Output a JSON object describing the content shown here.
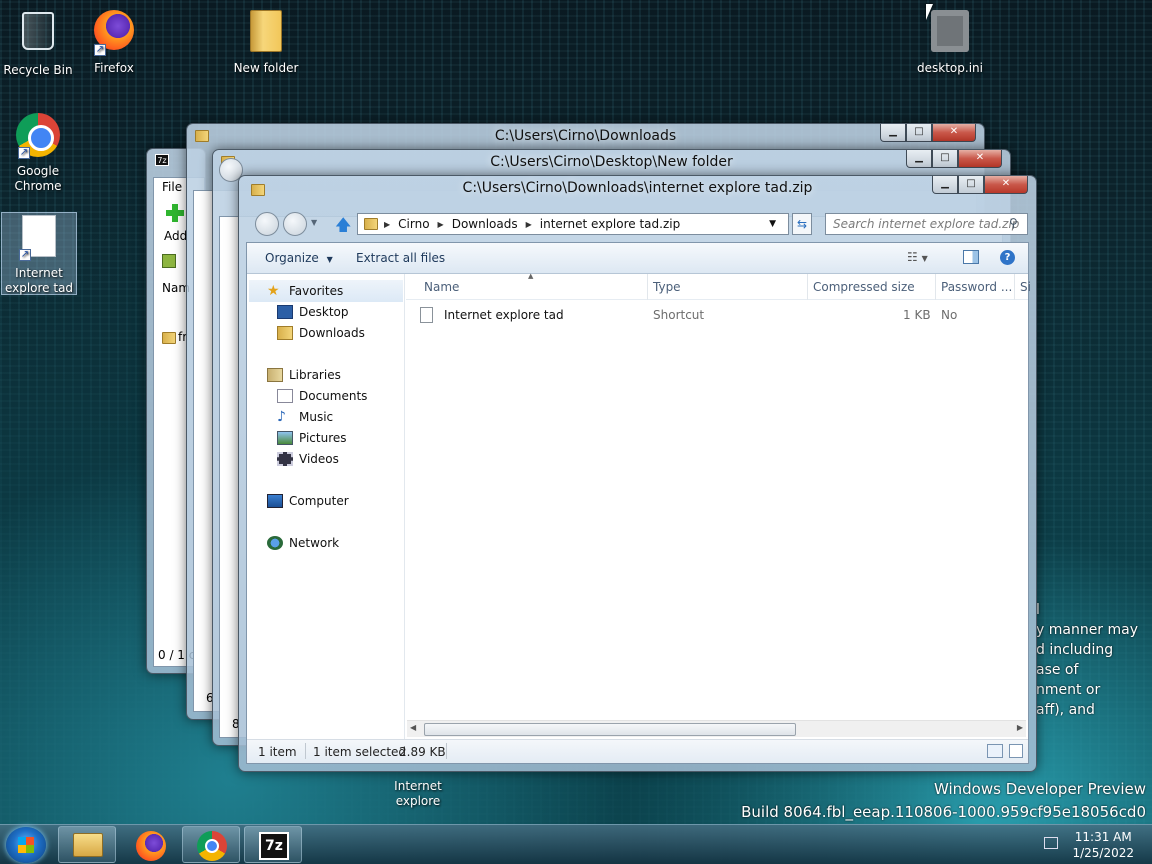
{
  "desktop": {
    "icons": [
      {
        "label": "Recycle Bin",
        "icon": "recycle-bin-icon"
      },
      {
        "label": "Firefox",
        "icon": "firefox-icon"
      },
      {
        "label": "New folder",
        "icon": "folder-icon"
      },
      {
        "label": "desktop.ini",
        "icon": "settings-file-icon"
      },
      {
        "label": "Google Chrome",
        "icon": "chrome-icon"
      },
      {
        "label": "Internet explore tad",
        "icon": "shortcut-file-icon"
      },
      {
        "label": "Internet explore",
        "icon": "shortcut-file-icon"
      }
    ],
    "legal_lines": [
      "l",
      "y manner may",
      "d including",
      "ase of",
      "nment or",
      "aff), and"
    ],
    "watermark": {
      "line1": "Windows Developer Preview",
      "line2": "Build 8064.fbl_eeap.110806-1000.959cf95e18056cd0"
    }
  },
  "windows": {
    "downloads": {
      "title": "C:\\Users\\Cirno\\Downloads",
      "status_fragment": "6"
    },
    "new_folder": {
      "title": "C:\\Users\\Cirno\\Desktop\\New folder",
      "status_fragment": "8"
    },
    "sevenzip": {
      "menu_file": "File",
      "add_label": "Add",
      "col_name": "Nam",
      "item_fragment": "fr",
      "status": "0 / 1 c"
    },
    "main": {
      "title": "C:\\Users\\Cirno\\Downloads\\internet explore tad.zip",
      "breadcrumb": [
        "Cirno",
        "Downloads",
        "internet explore tad.zip"
      ],
      "search_placeholder": "Search internet explore tad.zip",
      "toolbar": {
        "organize": "Organize",
        "extract_all": "Extract all files"
      },
      "nav": {
        "favorites": "Favorites",
        "desktop": "Desktop",
        "downloads": "Downloads",
        "libraries": "Libraries",
        "documents": "Documents",
        "music": "Music",
        "pictures": "Pictures",
        "videos": "Videos",
        "computer": "Computer",
        "network": "Network"
      },
      "columns": [
        "Name",
        "Type",
        "Compressed size",
        "Password ...",
        "Si"
      ],
      "files": [
        {
          "name": "Internet explore tad",
          "type": "Shortcut",
          "compressed_size": "1 KB",
          "password": "No"
        }
      ],
      "status": {
        "count": "1 item",
        "selected": "1 item selected",
        "size": "2.89 KB"
      }
    }
  },
  "taskbar": {
    "apps": [
      "file-explorer-icon",
      "firefox-icon",
      "chrome-icon",
      "7zip-icon"
    ],
    "time": "11:31 AM",
    "date": "1/25/2022"
  }
}
